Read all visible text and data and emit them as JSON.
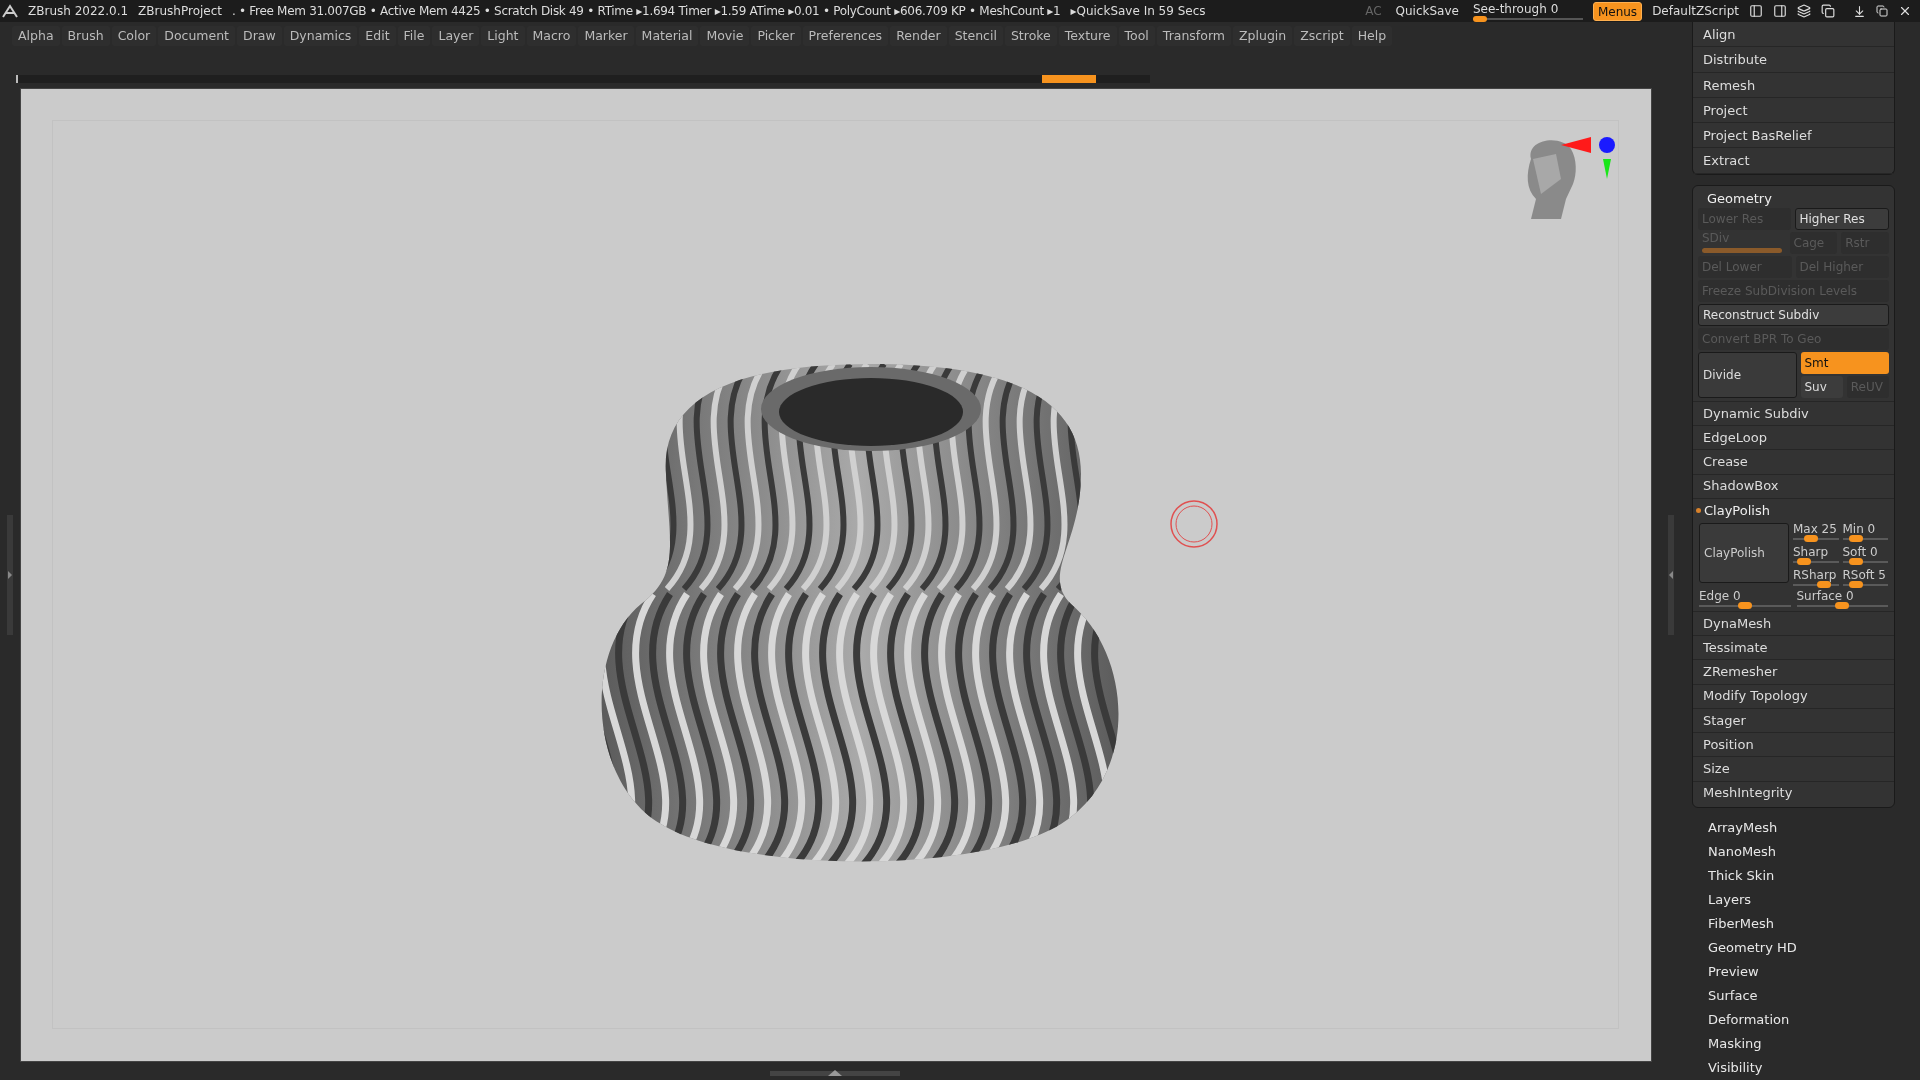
{
  "title_bar": {
    "app": "ZBrush 2022.0.1",
    "project": "ZBrushProject",
    "stats": ". • Free Mem 31.007GB • Active Mem 4425 • Scratch Disk 49 •  RTime ▸1.694 Timer ▸1.59 ATime ▸0.01 • PolyCount ▸606.709 KP • MeshCount ▸1",
    "quicksave_timer": "▸QuickSave In 59 Secs",
    "ac": "AC",
    "quicksave": "QuickSave",
    "see_through": {
      "label": "See-through",
      "value": "0",
      "level": 0
    },
    "menus": {
      "label": "Menus",
      "on": true
    },
    "script": "DefaultZScript"
  },
  "menu_bar": [
    "Alpha",
    "Brush",
    "Color",
    "Document",
    "Draw",
    "Dynamics",
    "Edit",
    "File",
    "Layer",
    "Light",
    "Macro",
    "Marker",
    "Material",
    "Movie",
    "Picker",
    "Preferences",
    "Render",
    "Stencil",
    "Stroke",
    "Texture",
    "Tool",
    "Transform",
    "Zplugin",
    "Zscript",
    "Help"
  ],
  "undo_history": {
    "level": 0.95
  },
  "tool_panel": {
    "top_items": [
      "Align",
      "Distribute",
      "Remesh",
      "Project",
      "Project BasRelief",
      "Extract"
    ],
    "geometry": {
      "title": "Geometry",
      "rows": [
        [
          {
            "kind": "button",
            "label": "Lower Res",
            "disabled": true
          },
          {
            "kind": "button",
            "label": "Higher Res",
            "disabled": false
          }
        ],
        [
          {
            "kind": "slider",
            "label": "SDiv",
            "disabled": true,
            "level": 1
          },
          {
            "kind": "button",
            "label": "Cage",
            "disabled": true
          },
          {
            "kind": "button",
            "label": "Rstr",
            "disabled": true
          }
        ],
        [
          {
            "kind": "button",
            "label": "Del Lower",
            "disabled": true
          },
          {
            "kind": "button",
            "label": "Del Higher",
            "disabled": true
          }
        ],
        [
          {
            "kind": "button",
            "label": "Freeze SubDivision Levels",
            "disabled": true
          }
        ],
        [
          {
            "kind": "button",
            "label": "Reconstruct Subdiv",
            "disabled": false
          }
        ],
        [
          {
            "kind": "button",
            "label": "Convert BPR To Geo",
            "disabled": true
          }
        ]
      ],
      "divide": {
        "label": "Divide",
        "options": [
          {
            "label": "Smt",
            "on": true,
            "disabled": false
          },
          {
            "label": "Suv",
            "on": false,
            "disabled": false
          },
          {
            "label": "ReUV",
            "disabled": true
          }
        ]
      },
      "items": [
        {
          "kind": "item",
          "label": "Dynamic Subdiv"
        },
        {
          "kind": "item",
          "label": "EdgeLoop"
        },
        {
          "kind": "item",
          "label": "Crease"
        },
        {
          "kind": "item",
          "label": "ShadowBox"
        },
        {
          "kind": "claypolish",
          "label": "ClayPolish",
          "active": true,
          "button": "ClayPolish",
          "sliders": [
            {
              "label": "Max 25",
              "level": 0.35
            },
            {
              "label": "Min 0",
              "level": 0.2
            },
            {
              "label": "Sharp",
              "level": 0.12
            },
            {
              "label": "Soft 0",
              "level": 0.2
            },
            {
              "label": "RSharp",
              "level": 0.75
            },
            {
              "label": "RSoft 5",
              "level": 0.2
            }
          ],
          "wide_sliders": [
            {
              "label": "Edge 0",
              "level": 0.5
            },
            {
              "label": "Surface 0",
              "level": 0.5
            }
          ]
        },
        {
          "kind": "item",
          "label": "DynaMesh"
        },
        {
          "kind": "item",
          "label": "Tessimate"
        },
        {
          "kind": "item",
          "label": "ZRemesher"
        },
        {
          "kind": "item",
          "label": "Modify Topology"
        },
        {
          "kind": "item",
          "label": "Stager"
        },
        {
          "kind": "item",
          "label": "Position"
        },
        {
          "kind": "item",
          "label": "Size"
        },
        {
          "kind": "item",
          "label": "MeshIntegrity"
        }
      ]
    },
    "subpalettes": [
      "ArrayMesh",
      "NanoMesh",
      "Thick Skin",
      "Layers",
      "FiberMesh",
      "Geometry HD",
      "Preview",
      "Surface",
      "Deformation",
      "Masking",
      "Visibility"
    ]
  }
}
